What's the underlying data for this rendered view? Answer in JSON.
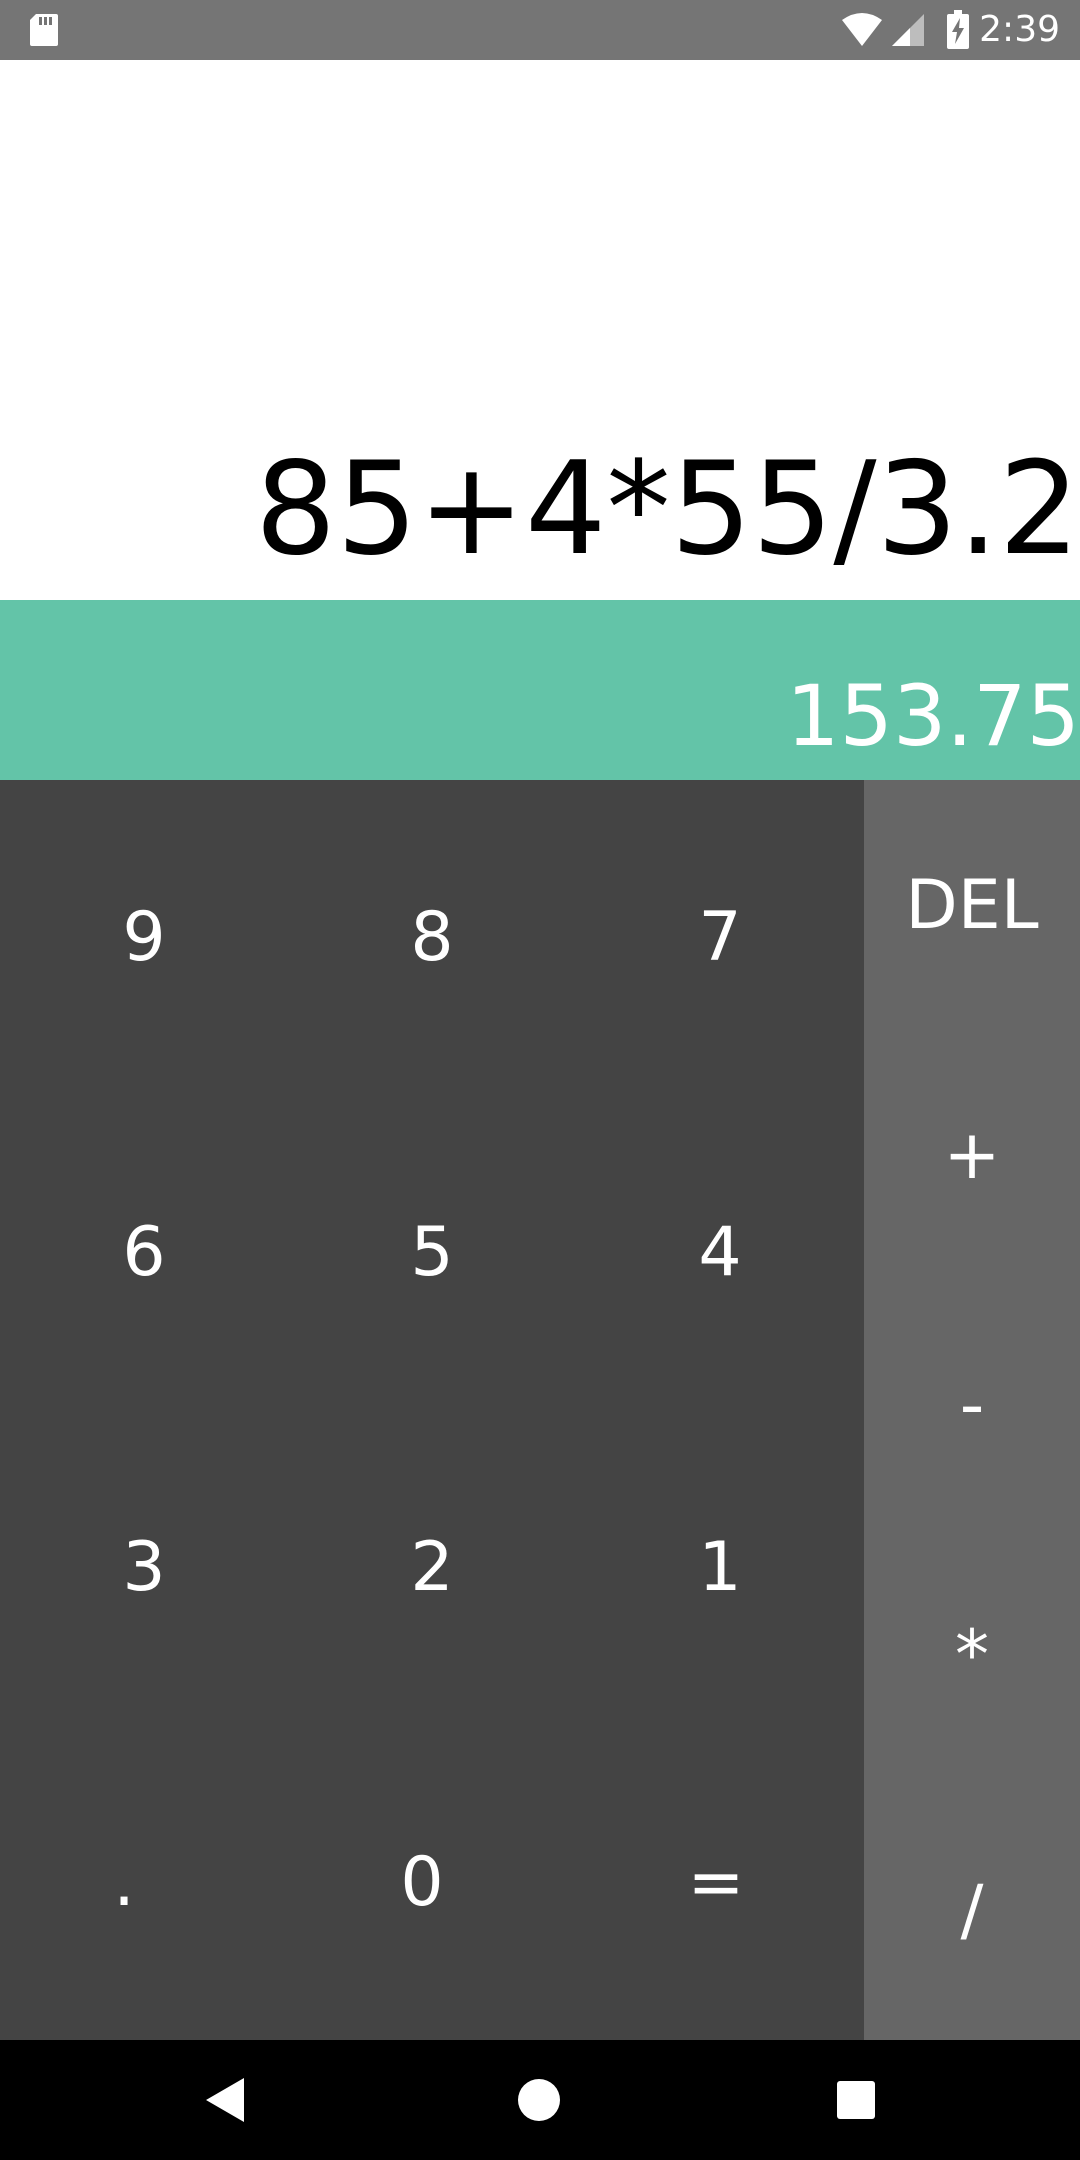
{
  "status_bar": {
    "time": "2:39",
    "icons": [
      "sd-card-icon",
      "wifi-icon",
      "signal-icon",
      "battery-charging-icon"
    ]
  },
  "display": {
    "expression": "85+4*55/3.2",
    "result": "153.75"
  },
  "numpad": {
    "rows": [
      [
        "9",
        "8",
        "7"
      ],
      [
        "6",
        "5",
        "4"
      ],
      [
        "3",
        "2",
        "1"
      ],
      [
        ".",
        "0",
        "="
      ]
    ]
  },
  "operators": {
    "delete": "DEL",
    "plus": "+",
    "minus": "-",
    "multiply": "*",
    "divide": "/"
  },
  "navigation": {
    "icons": [
      "back-icon",
      "home-icon",
      "recents-icon"
    ]
  },
  "colors": {
    "status_bar": "#757575",
    "result_bg": "#63c4a8",
    "numpad_bg": "#444444",
    "operators_bg": "#666666"
  }
}
